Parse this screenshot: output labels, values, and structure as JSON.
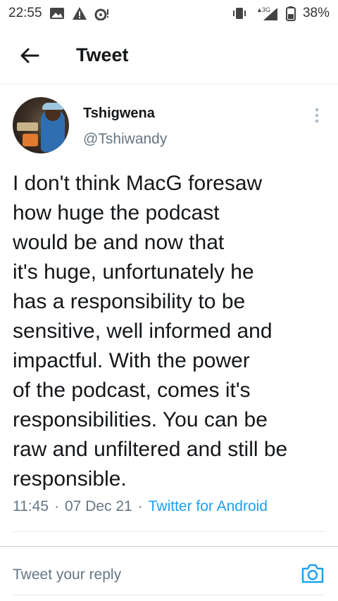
{
  "status_bar": {
    "time": "22:55",
    "network": "3G",
    "battery": "38%",
    "icons_left": [
      "image-icon",
      "alert-icon",
      "wireless-icon"
    ],
    "icons_right": [
      "vibrate-icon",
      "signal-icon",
      "battery-icon"
    ]
  },
  "header": {
    "back_icon": "back-arrow-icon",
    "title": "Tweet"
  },
  "tweet": {
    "author": {
      "display_name": "Tshigwena",
      "handle": "@Tshiwandy"
    },
    "text": "I don't think MacG foresaw\nhow huge the podcast\nwould be and now that\nit's huge, unfortunately he\nhas a responsibility to be\nsensitive, well informed and\nimpactful. With the power\nof the podcast, comes it's\nresponsibilities. You can be\nraw and unfiltered and still be\nresponsible.",
    "time": "11:45",
    "date": "07 Dec 21",
    "source": "Twitter for Android",
    "separator": "·"
  },
  "reply": {
    "placeholder": "Tweet your reply",
    "camera_icon": "camera-icon"
  },
  "colors": {
    "accent": "#1da1f2",
    "text": "#14171a",
    "secondary": "#657786"
  }
}
